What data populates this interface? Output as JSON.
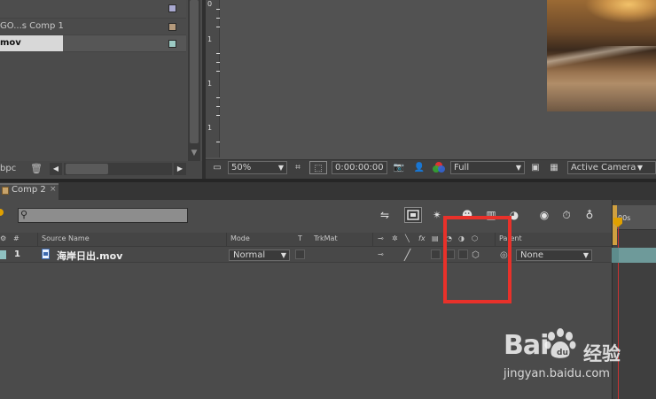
{
  "project": {
    "rows": [
      {
        "name": "",
        "swatch": "#a8a8d0"
      },
      {
        "name": "GO...s Comp 1",
        "swatch": "#b49a7c"
      },
      {
        "name": "mov",
        "swatch": "#9ccac4"
      }
    ],
    "bpc": "bpc"
  },
  "viewer": {
    "ruler_numbers": [
      "0",
      "1",
      "1",
      "1"
    ],
    "zoom": "50%",
    "timecode": "0:00:00:00",
    "resolution": "Full",
    "view": "Active Camera"
  },
  "timeline": {
    "tab_label": "Comp 2",
    "tab_close": "×",
    "columns": {
      "num": "#",
      "source_name": "Source Name",
      "mode": "Mode",
      "t": "T",
      "trkmat": "TrkMat",
      "parent": "Parent"
    },
    "layer": {
      "number": "1",
      "name": "海岸日出.mov",
      "mode": "Normal",
      "parent": "None"
    },
    "time_label": "00s"
  },
  "watermark": {
    "logo": "Bai",
    "logo_cn": "经验",
    "url": "jingyan.baidu.com"
  },
  "colors": {
    "highlight": "#e8312a",
    "cti": "#cc3333",
    "layer_bar": "#6e9a9a"
  }
}
